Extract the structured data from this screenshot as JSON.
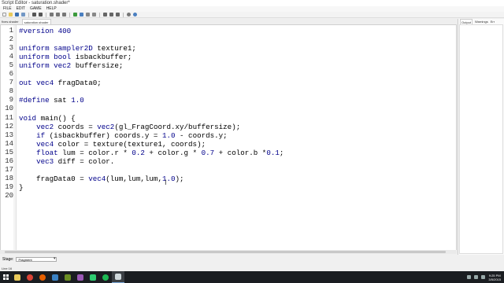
{
  "window": {
    "title": "Script Editor - saturation.shader*"
  },
  "menu": [
    "FILE",
    "EDIT",
    "GAME",
    "HELP"
  ],
  "toolbar": {
    "buttons": [
      "new-icon",
      "open-icon",
      "save-icon",
      "save-all-icon",
      "undo-icon",
      "redo-icon",
      "cut-icon",
      "copy-icon",
      "paste-icon",
      "run-icon",
      "step-icon",
      "pause-icon",
      "stop-icon",
      "indent-icon",
      "outdent-icon",
      "comment-icon",
      "settings-icon",
      "help-icon"
    ]
  },
  "tabs": [
    "fixes.shader",
    "saturation.shader"
  ],
  "editor": {
    "lines": [
      {
        "n": "1",
        "t": "#version 400"
      },
      {
        "n": "2",
        "t": ""
      },
      {
        "n": "3",
        "t": "uniform sampler2D texture1;"
      },
      {
        "n": "4",
        "t": "uniform bool isbackbuffer;"
      },
      {
        "n": "5",
        "t": "uniform vec2 buffersize;"
      },
      {
        "n": "6",
        "t": ""
      },
      {
        "n": "7",
        "t": "out vec4 fragData0;"
      },
      {
        "n": "8",
        "t": ""
      },
      {
        "n": "9",
        "t": "#define sat 1.0"
      },
      {
        "n": "10",
        "t": ""
      },
      {
        "n": "11",
        "t": "void main() {"
      },
      {
        "n": "12",
        "t": "    vec2 coords = vec2(gl_FragCoord.xy/buffersize);"
      },
      {
        "n": "13",
        "t": "    if (isbackbuffer) coords.y = 1.0 - coords.y;"
      },
      {
        "n": "14",
        "t": "    vec4 color = texture(texture1, coords);"
      },
      {
        "n": "15",
        "t": "    float lum = color.r * 0.2 + color.g * 0.7 + color.b *0.1;"
      },
      {
        "n": "16",
        "t": "    vec3 diff = color."
      },
      {
        "n": "17",
        "t": ""
      },
      {
        "n": "18",
        "t": "    fragData0 = vec4(lum,lum,lum,1.0);"
      },
      {
        "n": "19",
        "t": "}"
      },
      {
        "n": "20",
        "t": ""
      }
    ]
  },
  "panel": {
    "tabs": [
      "Output",
      "Warnings",
      "Err"
    ]
  },
  "stage": {
    "label": "Stage:",
    "value": "Fragment"
  },
  "status": {
    "text": "Line 16"
  },
  "taskbar": {
    "clock_time": "9:25 PM",
    "clock_date": "3/5/2015"
  },
  "colors": {
    "keyword": "#00008b",
    "editor_bg": "#ffffff",
    "taskbar_bg": "#1a1d21"
  }
}
